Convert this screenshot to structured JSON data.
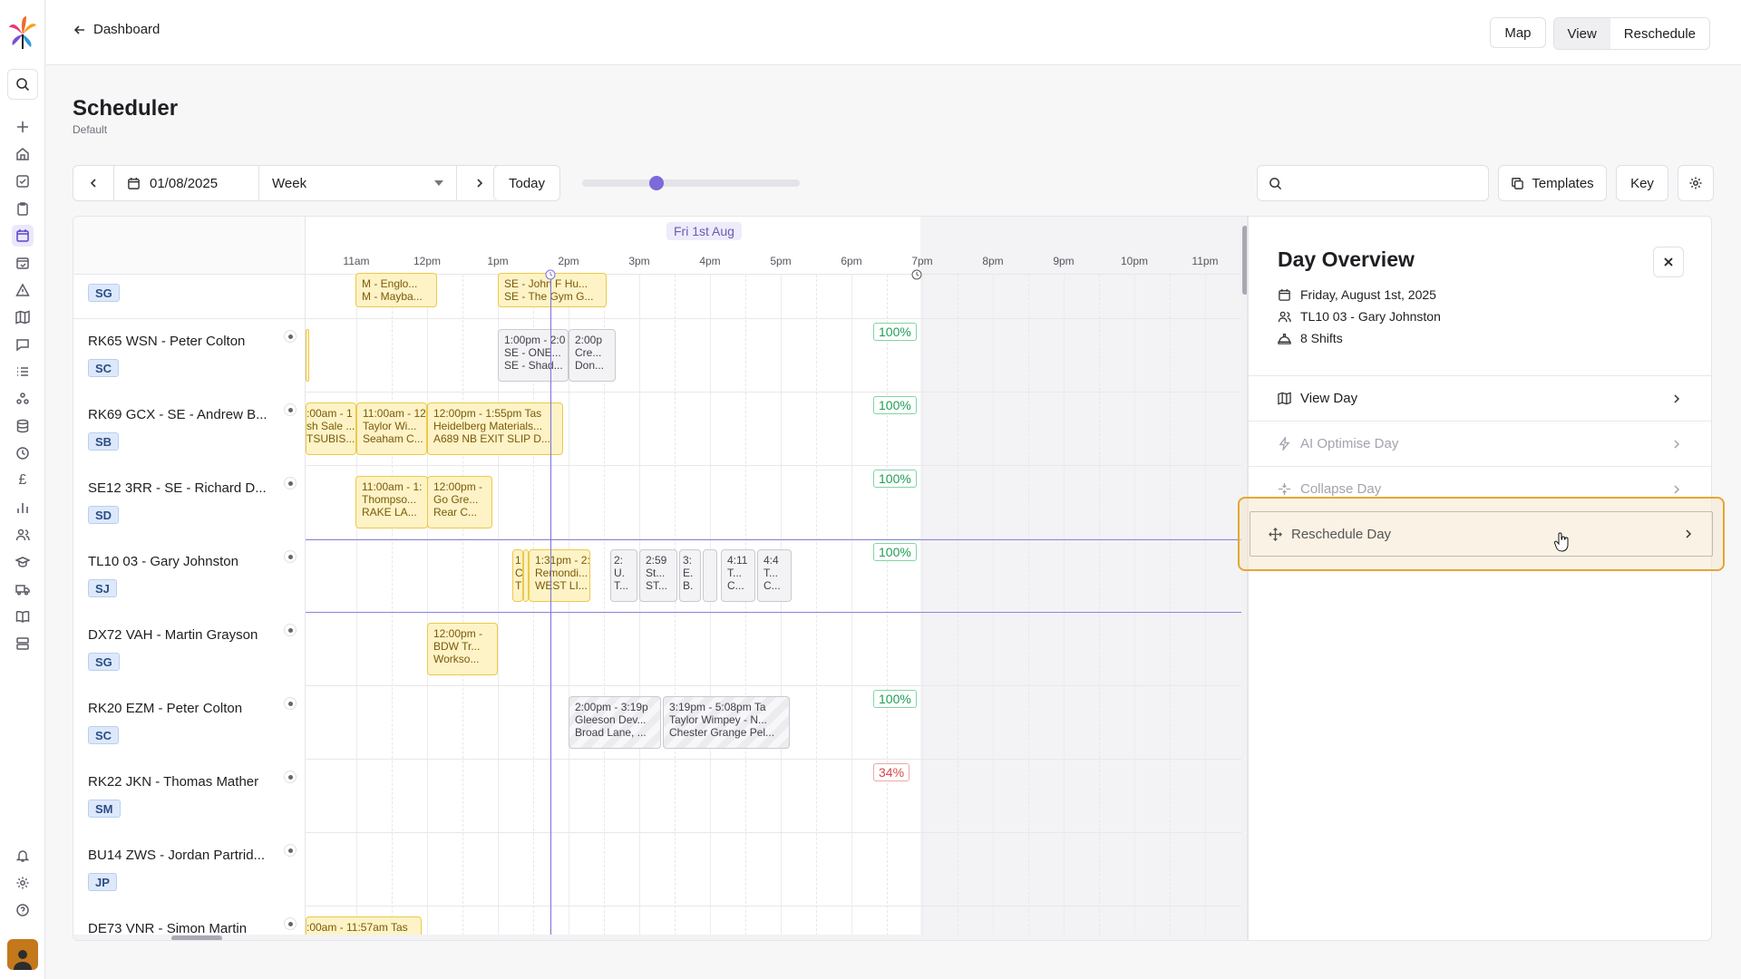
{
  "header": {
    "back_label": "Dashboard",
    "map_label": "Map",
    "view_label": "View",
    "reschedule_label": "Reschedule"
  },
  "page": {
    "title": "Scheduler",
    "subtitle": "Default"
  },
  "toolbar": {
    "date": "01/08/2025",
    "range": "Week",
    "today_label": "Today",
    "zoom_fraction": 0.33,
    "search_placeholder": "",
    "templates_label": "Templates",
    "key_label": "Key"
  },
  "timeline": {
    "day_label": "Fri 1st Aug",
    "hours": [
      "11am",
      "12pm",
      "1pm",
      "2pm",
      "3pm",
      "4pm",
      "5pm",
      "6pm",
      "7pm",
      "8pm",
      "9pm",
      "10pm",
      "11pm"
    ]
  },
  "rows": [
    {
      "name": "",
      "badge": "SG"
    },
    {
      "name": "RK65 WSN - Peter Colton",
      "badge": "SC",
      "pct": "100%"
    },
    {
      "name": "RK69 GCX - SE - Andrew B...",
      "badge": "SB",
      "pct": "100%"
    },
    {
      "name": "SE12 3RR - SE - Richard D...",
      "badge": "SD",
      "pct": "100%"
    },
    {
      "name": "TL10 03 - Gary Johnston",
      "badge": "SJ",
      "pct": "100%"
    },
    {
      "name": "DX72 VAH - Martin Grayson",
      "badge": "SG"
    },
    {
      "name": "RK20 EZM - Peter Colton",
      "badge": "SC",
      "pct": "100%"
    },
    {
      "name": "RK22 JKN - Thomas Mather",
      "badge": "SM",
      "pct": "34%"
    },
    {
      "name": "BU14 ZWS - Jordan Partrid...",
      "badge": "JP"
    },
    {
      "name": "DE73 VNR - Simon Martin",
      "badge": ""
    }
  ],
  "shifts": {
    "r0a": [
      "M - Englo...",
      "M - Mayba..."
    ],
    "r0b": [
      "SE - John F Hu...",
      "SE - The Gym G..."
    ],
    "r1a": [
      "1:00pm - 2:0",
      "SE - ONE...",
      "SE - Shad..."
    ],
    "r1b": [
      "2:00p",
      "Cre...",
      "Don..."
    ],
    "r2a": [
      ":00am - 1",
      "sh Sale ...",
      "TSUBIS..."
    ],
    "r2b": [
      "11:00am - 12",
      "Taylor Wi...",
      "Seaham C..."
    ],
    "r2c": [
      "12:00pm - 1:55pm  Tas",
      "Heidelberg Materials...",
      "A689 NB EXIT SLIP D..."
    ],
    "r3a": [
      "11:00am - 1:",
      "Thompso...",
      "RAKE LA..."
    ],
    "r3b": [
      "12:00pm -",
      "Go Gre...",
      "Rear C..."
    ],
    "r4a": [
      "1",
      "C",
      "T"
    ],
    "r4b": [
      "1:31pm - 2:",
      "Remondi...",
      "WEST LI..."
    ],
    "r4c": [
      "2:",
      "U.",
      "T..."
    ],
    "r4d": [
      "2:59",
      "St...",
      "ST..."
    ],
    "r4e": [
      "3:",
      "E.",
      "B."
    ],
    "r4f": [
      "4:11",
      "T...",
      "C..."
    ],
    "r4g": [
      "4:4",
      "T...",
      "C..."
    ],
    "r5a": [
      "12:00pm -",
      "BDW Tr...",
      "Workso..."
    ],
    "r6a": [
      "2:00pm - 3:19p",
      "Gleeson Dev...",
      "Broad Lane, ..."
    ],
    "r6b": [
      "3:19pm - 5:08pm  Ta",
      "Taylor Wimpey - N...",
      "Chester Grange Pel..."
    ],
    "r9a": [
      ":00am - 11:57am  Tas"
    ]
  },
  "panel": {
    "title": "Day Overview",
    "date": "Friday, August 1st, 2025",
    "vehicle": "TL10 03 - Gary Johnston",
    "shifts": "8 Shifts",
    "options": [
      "View Day",
      "AI Optimise Day",
      "Collapse Day",
      "Reschedule Day"
    ]
  },
  "colors": {
    "accent": "#7c6adb",
    "shift_yellow": "#fdf3c6",
    "highlight": "#e6a632",
    "success": "#1f9e54",
    "danger": "#d84848"
  }
}
